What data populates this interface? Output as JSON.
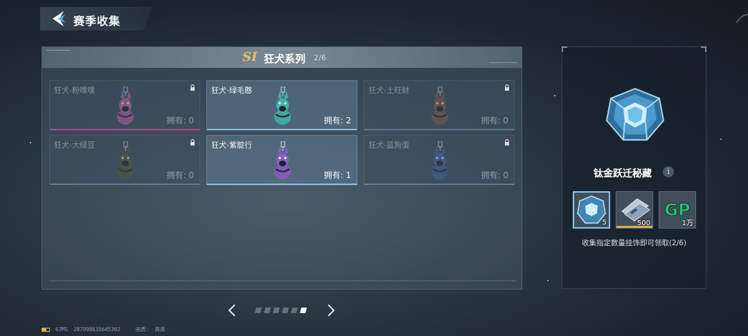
{
  "header": {
    "title": "赛季收集"
  },
  "series": {
    "season_tag": "SI",
    "title": "狂犬系列",
    "progress": "2/6"
  },
  "cards": [
    {
      "name": "狂犬-粉噗噗",
      "owned_label": "拥有: 0",
      "color": "#c85fb0",
      "owned": false,
      "locked": true
    },
    {
      "name": "狂犬-绿毛憨",
      "owned_label": "拥有: 2",
      "color": "#3fb3a4",
      "owned": true,
      "locked": false
    },
    {
      "name": "狂犬-土旺财",
      "owned_label": "拥有: 0",
      "color": "#8a5a44",
      "owned": false,
      "locked": true
    },
    {
      "name": "狂犬-大绿豆",
      "owned_label": "拥有: 0",
      "color": "#4f5a3e",
      "owned": false,
      "locked": true
    },
    {
      "name": "狂犬-紫腚行",
      "owned_label": "拥有: 1",
      "color": "#8a5cc4",
      "owned": true,
      "locked": false
    },
    {
      "name": "狂犬-蓝狗蛋",
      "owned_label": "拥有: 0",
      "color": "#4a62a8",
      "owned": false,
      "locked": true
    }
  ],
  "pagination": {
    "total_pages": 6,
    "current_page": 6
  },
  "reward": {
    "name": "钛金跃迁秘藏",
    "info_icon": "i",
    "items": [
      {
        "icon": "titanium-chest-icon",
        "qty": "5"
      },
      {
        "icon": "voucher-card-icon",
        "qty": "500"
      },
      {
        "icon": "gp-coin-icon",
        "text": "GP",
        "qty": "1万"
      }
    ],
    "description": "收集指定数量挂饰即可领取(2/6)"
  },
  "footer": {
    "ping": "67MS",
    "user_id": "287998635645302",
    "quality_label": "画质:",
    "quality_value": "高清"
  },
  "colors": {
    "accent": "#8fc6ea",
    "gold": "#e7c06a",
    "gp_green": "#2fbf7a"
  }
}
